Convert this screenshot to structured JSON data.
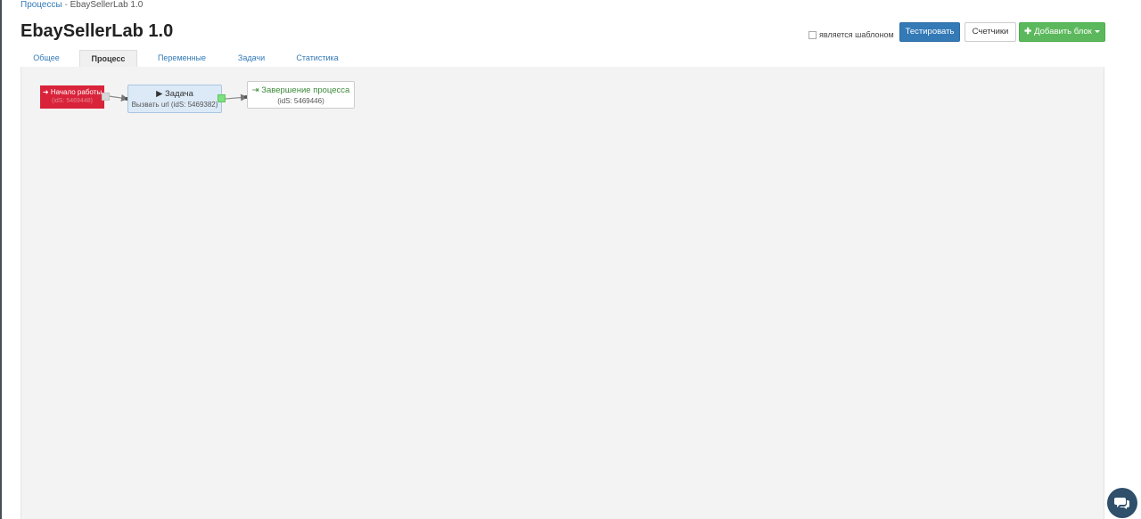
{
  "breadcrumb": {
    "parent": "Процессы",
    "separator": "-",
    "current": "EbaySellerLab 1.0"
  },
  "page": {
    "title": "EbaySellerLab 1.0"
  },
  "toolbar": {
    "template_label": "является шаблоном",
    "template_checked": false,
    "test_label": "Тестировать",
    "counters_label": "Счетчики",
    "add_block_label": "Добавить блок"
  },
  "tabs": [
    {
      "label": "Общее"
    },
    {
      "label": "Процесс",
      "active": true
    },
    {
      "label": "Переменные"
    },
    {
      "label": "Задачи"
    },
    {
      "label": "Статистика"
    }
  ],
  "flow": {
    "start": {
      "label": "Начало работы",
      "id": "(idS: 5469448)",
      "icon": "sign-in-icon"
    },
    "task": {
      "label": "Задача",
      "subtitle": "Вызвать url (idS: 5469382)",
      "icon": "play-icon"
    },
    "end": {
      "label": "Завершение процесса",
      "id": "(idS: 5469446)",
      "icon": "sign-out-icon"
    }
  },
  "colors": {
    "primary": "#337ab7",
    "success": "#5cb85c",
    "start_node": "#d9233a",
    "task_node": "#dceaf7",
    "end_text": "#3c8a3a"
  }
}
